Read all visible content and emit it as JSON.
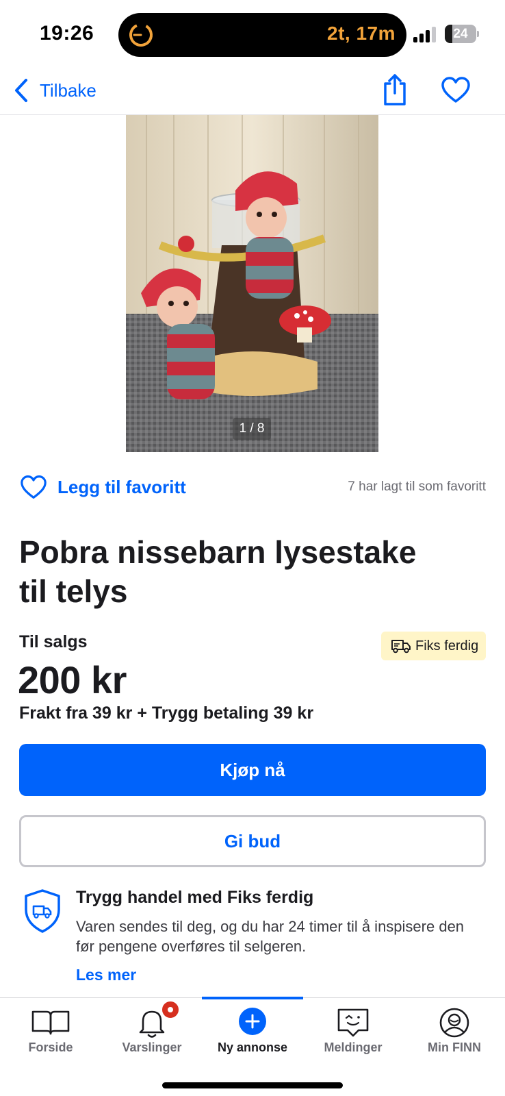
{
  "status_bar": {
    "time": "19:26",
    "timer": "2t, 17m",
    "battery": "24",
    "battery_level": 0.24,
    "signal_bars": 3
  },
  "nav": {
    "back_label": "Tilbake",
    "share_icon": "share-icon",
    "favorite_icon": "heart-outline-icon"
  },
  "image": {
    "counter": "1 / 8",
    "description_icon": "product-photo"
  },
  "favorite": {
    "link_label": "Legg til favoritt",
    "count_text": "7 har lagt til som favoritt"
  },
  "listing": {
    "title_line1": "Pobra nissebarn lysestake",
    "title_line2": "til telys",
    "sale_label": "Til salgs",
    "badge_label": "Fiks ferdig",
    "price": "200 kr",
    "shipping": "Frakt fra 39 kr + Trygg betaling 39 kr"
  },
  "actions": {
    "buy_label": "Kjøp nå",
    "bid_label": "Gi bud"
  },
  "safe_trade": {
    "heading": "Trygg handel med Fiks ferdig",
    "body": "Varen sendes til deg, og du har 24 timer til å inspisere den før pengene overføres til selgeren.",
    "link": "Les mer"
  },
  "tabbar": {
    "items": [
      {
        "label": "Forside",
        "icon": "book-icon"
      },
      {
        "label": "Varslinger",
        "icon": "bell-icon"
      },
      {
        "label": "Ny annonse",
        "icon": "plus-circle-icon"
      },
      {
        "label": "Meldinger",
        "icon": "chat-icon"
      },
      {
        "label": "Min FINN",
        "icon": "profile-icon"
      }
    ],
    "active_index": 2
  },
  "colors": {
    "accent": "#0063fb",
    "badge_bg": "#fff5c8",
    "notification": "#d62f1f",
    "timer": "#f2a33a"
  }
}
